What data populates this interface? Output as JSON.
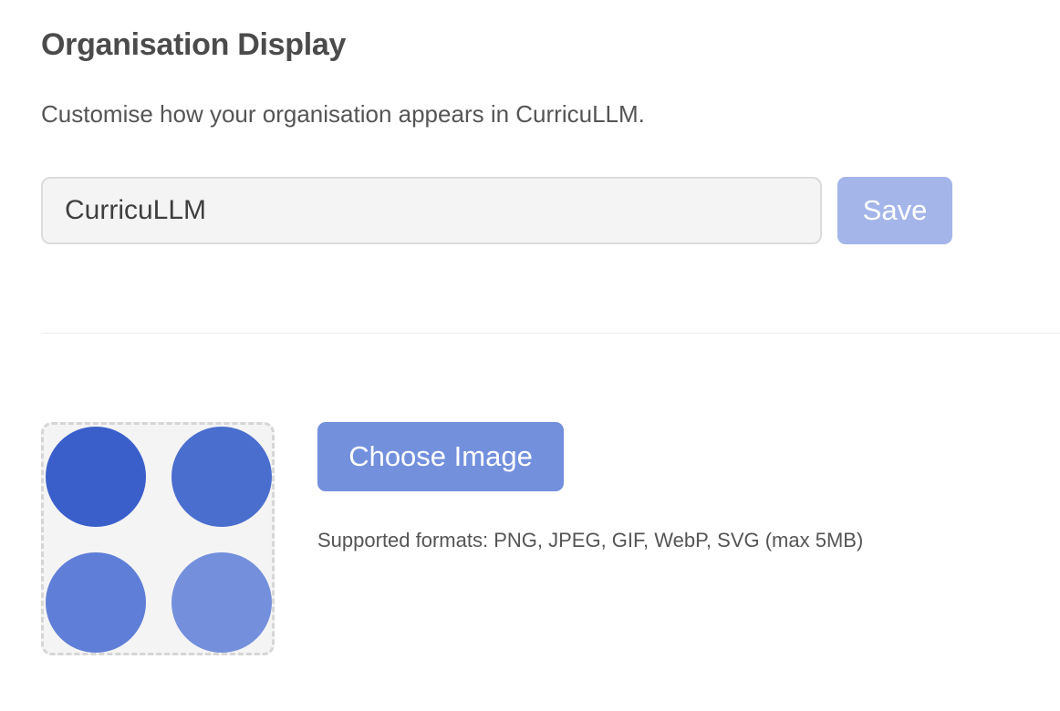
{
  "section": {
    "title": "Organisation Display",
    "subtitle": "Customise how your organisation appears in CurricuLLM."
  },
  "name_form": {
    "input_value": "CurricuLLM",
    "save_label": "Save"
  },
  "logo": {
    "icon": "four-circles-logo-icon",
    "circle_colors": [
      "#3a5fcb",
      "#4a6ece",
      "#5f7ed7",
      "#7490dc"
    ],
    "choose_label": "Choose Image",
    "formats_text": "Supported formats: PNG, JPEG, GIF, WebP, SVG (max 5MB)"
  },
  "colors": {
    "save_button_bg": "#a4b5e9",
    "choose_button_bg": "#7390dd"
  }
}
